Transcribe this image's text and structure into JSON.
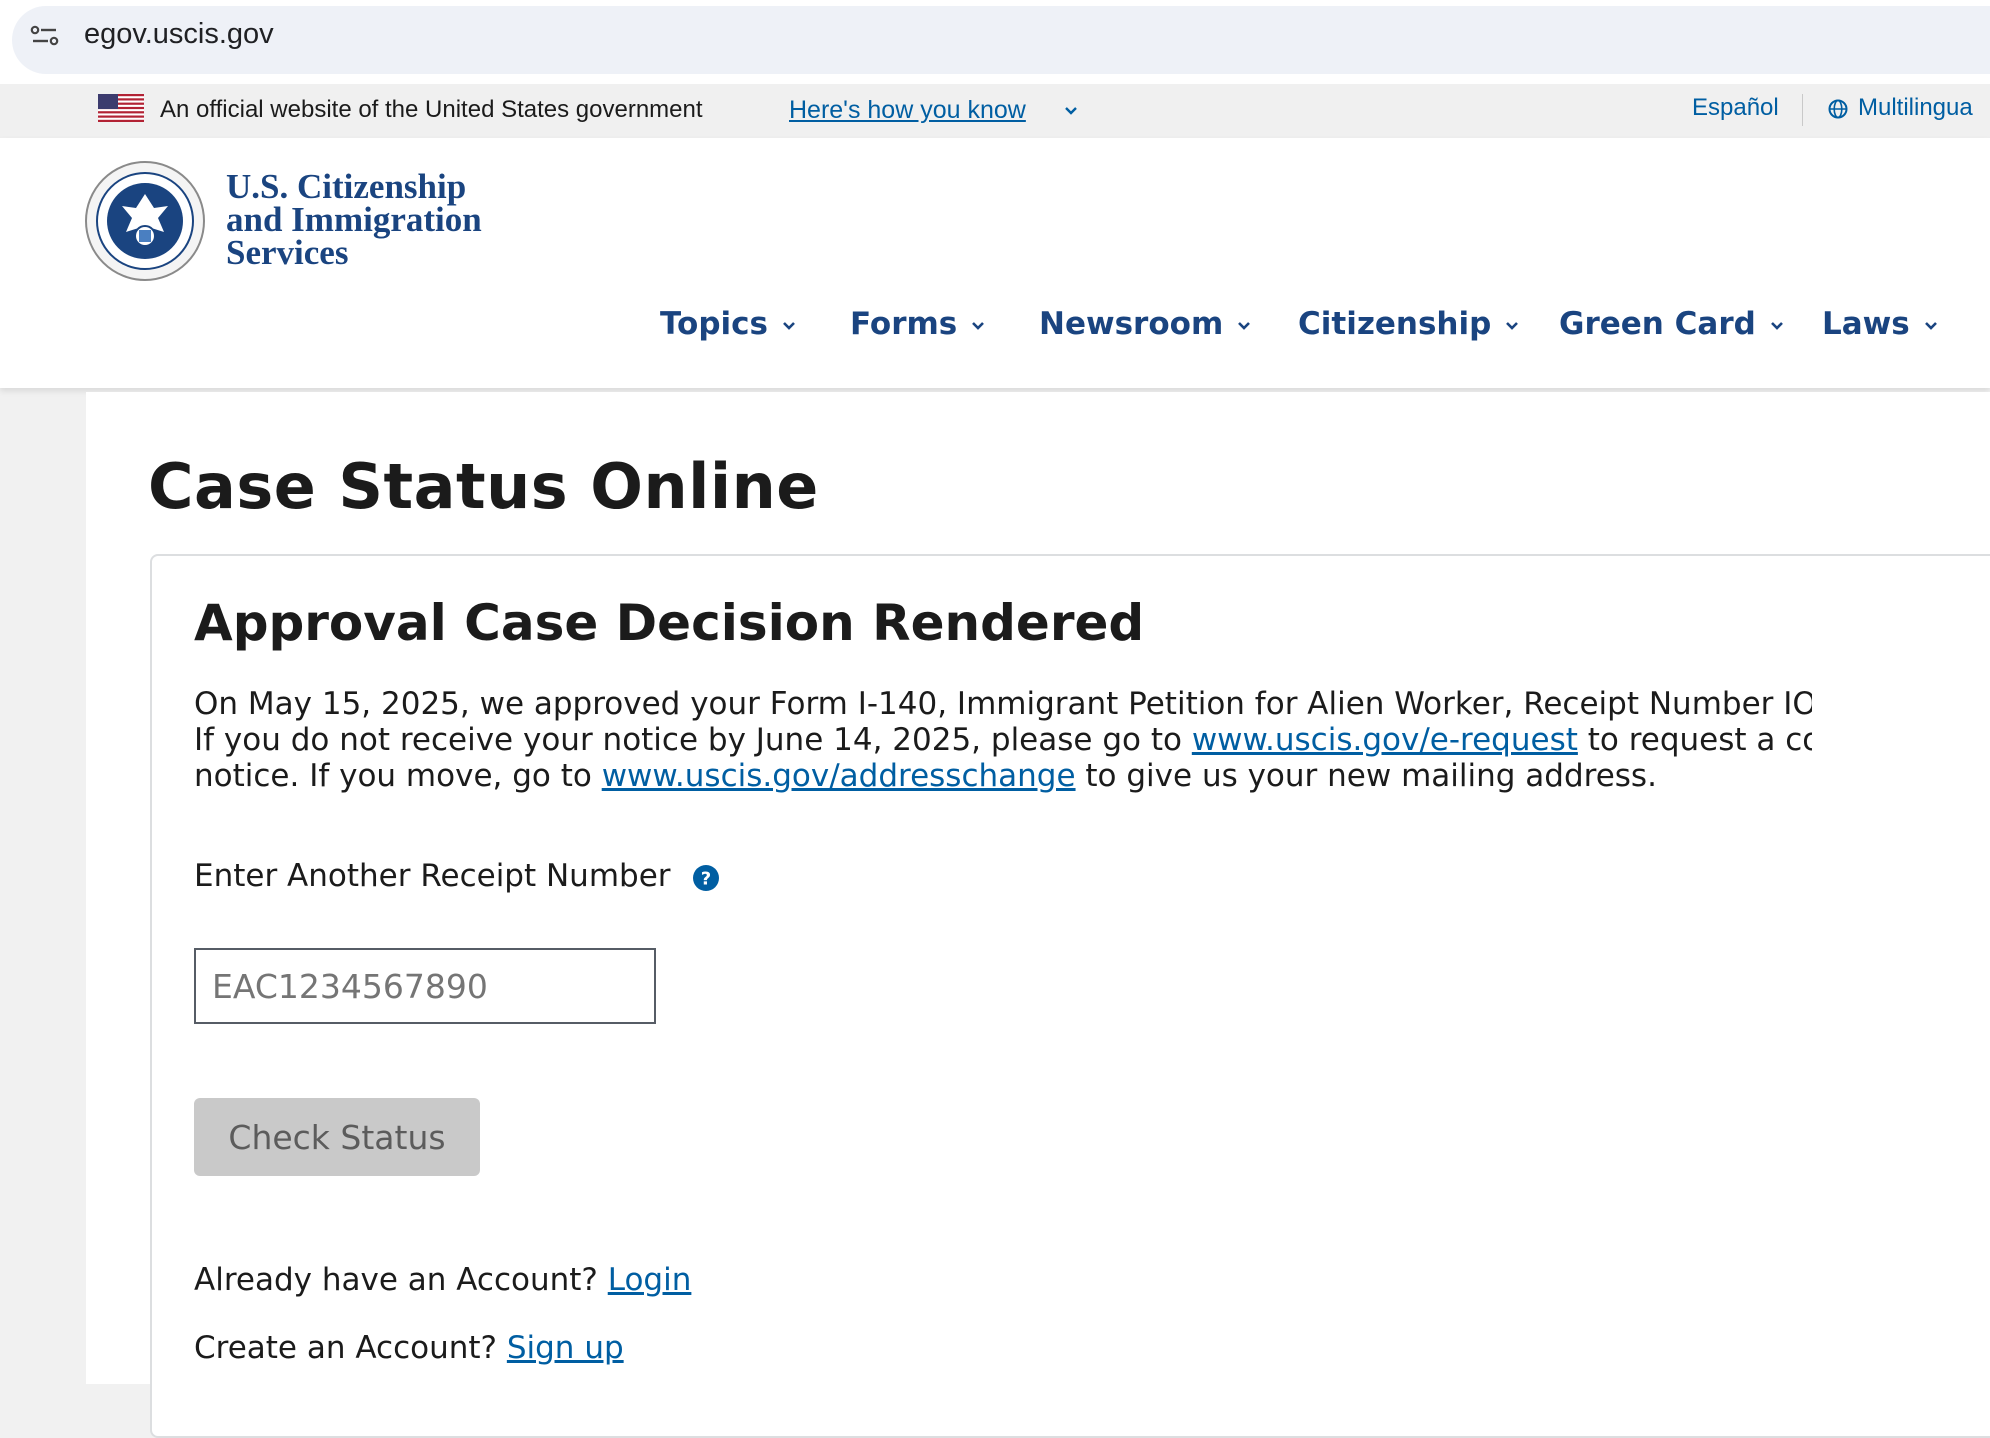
{
  "browser": {
    "url": "egov.uscis.gov"
  },
  "gov_banner": {
    "official_text": "An official website of the United States government",
    "how_you_know": "Here's how you know",
    "espanol": "Español",
    "multilingual": "Multilingua"
  },
  "header": {
    "logo_lines": [
      "U.S. Citizenship",
      "and Immigration",
      "Services"
    ],
    "nav": [
      {
        "label": "Topics"
      },
      {
        "label": "Forms"
      },
      {
        "label": "Newsroom"
      },
      {
        "label": "Citizenship"
      },
      {
        "label": "Green Card"
      },
      {
        "label": "Laws"
      }
    ]
  },
  "main": {
    "title": "Case Status Online",
    "status_heading": "Approval Case Decision Rendered",
    "status_body": {
      "line1": "On May 15, 2025, we approved your Form I-140, Immigrant Petition for Alien Worker, Receipt Number IOI",
      "line2_pre": "If you do not receive your notice by June 14, 2025, please go to ",
      "line2_link": "www.uscis.gov/e-request",
      "line2_post": " to request a cop",
      "line3_pre": "notice. If you move, go to ",
      "line3_link": "www.uscis.gov/addresschange",
      "line3_post": " to give us your new mailing address."
    },
    "receipt_label": "Enter Another Receipt Number",
    "receipt_placeholder": "EAC1234567890",
    "check_button": "Check Status",
    "account": {
      "login_prompt": "Already have an Account?",
      "login_link": "Login",
      "signup_prompt": "Create an Account?",
      "signup_link": "Sign up"
    }
  },
  "colors": {
    "link": "#005ea2",
    "nav": "#1a4480",
    "button_disabled": "#c9c9c9"
  }
}
